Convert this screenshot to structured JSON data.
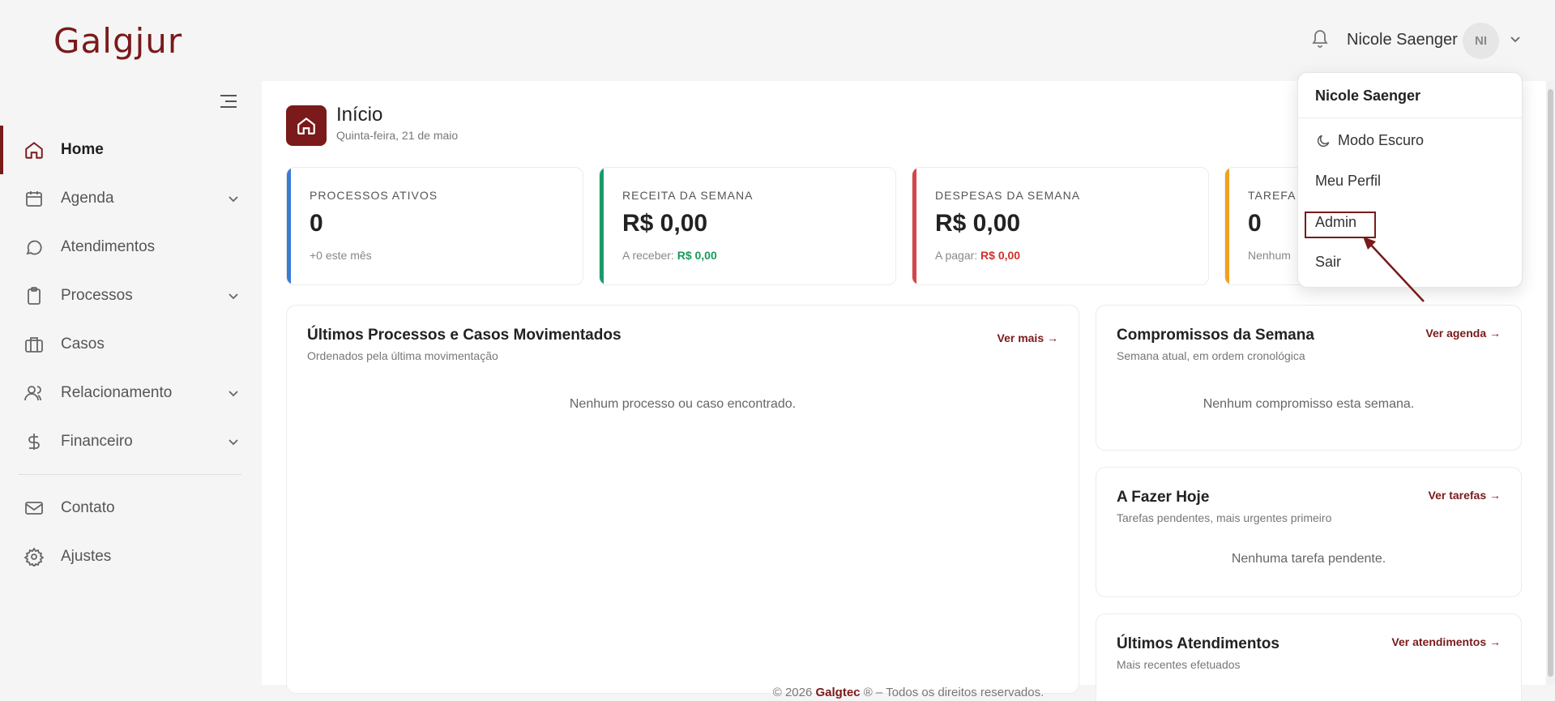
{
  "header": {
    "logo": "Galgjur",
    "user_name": "Nicole Saenger",
    "avatar_initials": "NI"
  },
  "sidebar": {
    "items": [
      {
        "label": "Home",
        "icon": "home-icon",
        "active": true
      },
      {
        "label": "Agenda",
        "icon": "calendar-icon",
        "expandable": true
      },
      {
        "label": "Atendimentos",
        "icon": "chat-icon"
      },
      {
        "label": "Processos",
        "icon": "clipboard-icon",
        "expandable": true
      },
      {
        "label": "Casos",
        "icon": "briefcase-icon"
      },
      {
        "label": "Relacionamento",
        "icon": "users-icon",
        "expandable": true
      },
      {
        "label": "Financeiro",
        "icon": "dollar-icon",
        "expandable": true
      },
      {
        "label": "Contato",
        "icon": "mail-icon"
      },
      {
        "label": "Ajustes",
        "icon": "gear-icon"
      }
    ]
  },
  "page": {
    "title": "Início",
    "subtitle": "Quinta-feira, 21 de maio"
  },
  "stats": [
    {
      "label": "PROCESSOS ATIVOS",
      "value": "0",
      "sub": "+0 este mês",
      "color": "#3a7bd5"
    },
    {
      "label": "RECEITA DA SEMANA",
      "value": "R$ 0,00",
      "sub_prefix": "A receber:",
      "sub_value": "R$ 0,00",
      "color": "#1a9a6a"
    },
    {
      "label": "DESPESAS DA SEMANA",
      "value": "R$ 0,00",
      "sub_prefix": "A pagar:",
      "sub_value": "R$ 0,00",
      "color": "#d64545"
    },
    {
      "label": "TAREFA",
      "value": "0",
      "sub": "Nenhum",
      "color": "#f0a020"
    }
  ],
  "panels": {
    "processes": {
      "title": "Últimos Processos e Casos Movimentados",
      "subtitle": "Ordenados pela última movimentação",
      "link": "Ver mais →",
      "empty": "Nenhum processo ou caso encontrado."
    },
    "commitments": {
      "title": "Compromissos da Semana",
      "subtitle": "Semana atual, em ordem cronológica",
      "link": "Ver agenda →",
      "empty": "Nenhum compromisso esta semana."
    },
    "todo": {
      "title": "A Fazer Hoje",
      "subtitle": "Tarefas pendentes, mais urgentes primeiro",
      "link": "Ver tarefas →",
      "empty": "Nenhuma tarefa pendente."
    },
    "attendances": {
      "title": "Últimos Atendimentos",
      "subtitle": "Mais recentes efetuados",
      "link": "Ver atendimentos →"
    }
  },
  "footer": {
    "prefix": "© 2026",
    "brand": "Galgtec",
    "suffix": "® – Todos os direitos reservados."
  },
  "dropdown": {
    "name": "Nicole Saenger",
    "dark_mode": "Modo Escuro",
    "profile": "Meu Perfil",
    "admin": "Admin",
    "logout": "Sair"
  }
}
